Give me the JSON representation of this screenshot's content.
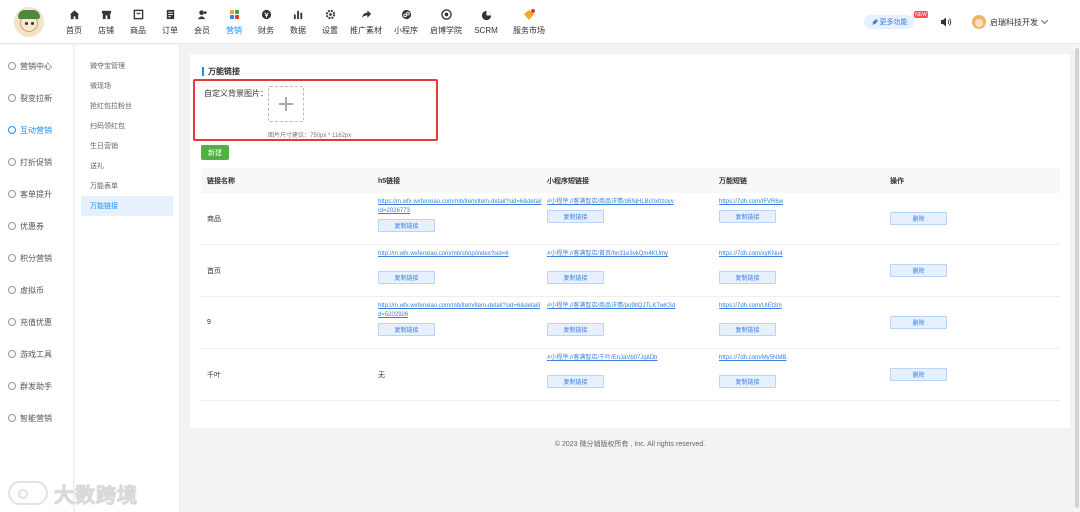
{
  "topnav": {
    "items": [
      {
        "label": "首页",
        "icon": "home-icon"
      },
      {
        "label": "店铺",
        "icon": "store-icon"
      },
      {
        "label": "商品",
        "icon": "goods-icon"
      },
      {
        "label": "订单",
        "icon": "order-icon"
      },
      {
        "label": "会员",
        "icon": "member-icon"
      },
      {
        "label": "营销",
        "icon": "marketing-icon"
      },
      {
        "label": "财务",
        "icon": "finance-icon"
      },
      {
        "label": "数据",
        "icon": "data-icon"
      },
      {
        "label": "设置",
        "icon": "settings-icon"
      },
      {
        "label": "推广素材",
        "icon": "share-icon"
      },
      {
        "label": "小程序",
        "icon": "miniapp-icon"
      },
      {
        "label": "启博学院",
        "icon": "academy-icon"
      },
      {
        "label": "SCRM",
        "icon": "scrm-icon"
      },
      {
        "label": "服务市场",
        "icon": "market-icon"
      }
    ],
    "active_index": 5,
    "more_label": "更多功能",
    "new_badge": "NEW",
    "username": "启瑞科技开发"
  },
  "sidebar1": {
    "items": [
      "营销中心",
      "裂变拉新",
      "互动营销",
      "打折促销",
      "客单提升",
      "优惠券",
      "积分营销",
      "虚拟币",
      "充值优惠",
      "游戏工具",
      "群发助手",
      "智能营销"
    ],
    "active_index": 2
  },
  "sidebar2": {
    "items": [
      "微夺宝管理",
      "微现场",
      "抢红包拉粉丝",
      "扫码领红包",
      "生日营销",
      "送礼",
      "万能表单",
      "万能链接"
    ],
    "active_index": 7
  },
  "main": {
    "title": "万能链接",
    "bg_label": "自定义背景图片：",
    "bg_hint": "图片尺寸建议：750px * 1162px",
    "new_button": "新建",
    "columns": [
      "链接名称",
      "h5链接",
      "小程序短链接",
      "万能短链",
      "操作"
    ],
    "copy_label": "复制链接",
    "delete_label": "删除",
    "rows": [
      {
        "name": "商品",
        "h5": "https://m.wfx.wxfenxiao.com/mb/item/item-detail?sid=6&detailId=2026773",
        "mini": "#小程序://客满智店/商品详情/d6NjHLBc0x0zoyv",
        "short": "https://7dh.com/IFVR6w"
      },
      {
        "name": "首页",
        "h5": "http://m.wfx.wxfenxiao.com/mb/shop/index?sid=6",
        "mini": "#小程序://客满智店/首页/hn31e3vkQm4KUmy",
        "short": "https://7dh.com/xyKNu4"
      },
      {
        "name": "9",
        "h5": "http://m.wfx.wxfenxiao.com/mb/item/item-detail?sid=6&detailId=5202926",
        "mini": "#小程序://客满智店/商品详情/po9tlQJTLKTwKSd",
        "short": "https://7dh.com/UIEt3m"
      },
      {
        "name": "千叶",
        "h5": "无",
        "mini": "#小程序://客满智店/千叶/EnJaVb07JgiIDb",
        "short": "https://7dh.com/My5NMB"
      }
    ]
  },
  "footer": "© 2023 微分销版权所有 , Inc. All rights reserved.",
  "watermark": "大数跨境"
}
